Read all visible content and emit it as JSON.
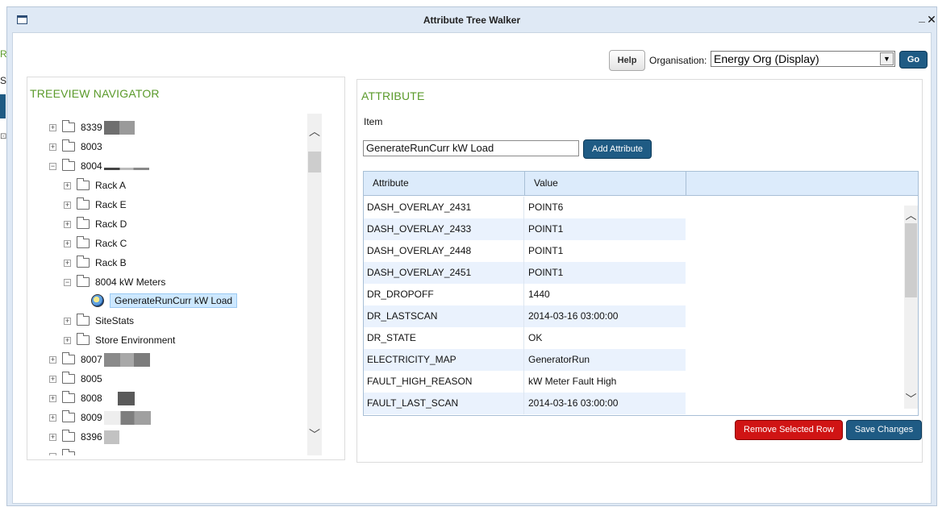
{
  "window": {
    "title": "Attribute Tree Walker",
    "minimize_glyph": "_",
    "close_glyph": "✕"
  },
  "toolbar": {
    "help_label": "Help",
    "organisation_label": "Organisation:",
    "organisation_value": "Energy Org (Display)",
    "go_label": "Go"
  },
  "tree": {
    "heading": "TREEVIEW NAVIGATOR",
    "items": [
      {
        "label": "8339",
        "expander": "+"
      },
      {
        "label": "8003",
        "expander": "+"
      },
      {
        "label": "8004",
        "expander": "−"
      },
      {
        "label": "Rack A",
        "expander": "+"
      },
      {
        "label": "Rack E",
        "expander": "+"
      },
      {
        "label": "Rack D",
        "expander": "+"
      },
      {
        "label": "Rack C",
        "expander": "+"
      },
      {
        "label": "Rack B",
        "expander": "+"
      },
      {
        "label": "8004 kW Meters",
        "expander": "−"
      },
      {
        "label": "GenerateRunCurr kW Load"
      },
      {
        "label": "SiteStats",
        "expander": "+"
      },
      {
        "label": "Store Environment",
        "expander": "+"
      },
      {
        "label": "8007",
        "expander": "+"
      },
      {
        "label": "8005",
        "expander": "+"
      },
      {
        "label": "8008",
        "expander": "+"
      },
      {
        "label": "8009",
        "expander": "+"
      },
      {
        "label": "8396",
        "expander": "+"
      }
    ]
  },
  "attribute": {
    "heading": "ATTRIBUTE",
    "item_label": "Item",
    "item_value": "GenerateRunCurr kW Load",
    "add_button": "Add Attribute",
    "columns": [
      "Attribute",
      "Value"
    ],
    "rows": [
      [
        "DASH_OVERLAY_2431",
        "POINT6"
      ],
      [
        "DASH_OVERLAY_2433",
        "POINT1"
      ],
      [
        "DASH_OVERLAY_2448",
        "POINT1"
      ],
      [
        "DASH_OVERLAY_2451",
        "POINT1"
      ],
      [
        "DR_DROPOFF",
        "1440"
      ],
      [
        "DR_LASTSCAN",
        "2014-03-16 03:00:00"
      ],
      [
        "DR_STATE",
        "OK"
      ],
      [
        "ELECTRICITY_MAP",
        "GeneratorRun"
      ],
      [
        "FAULT_HIGH_REASON",
        "kW Meter Fault High"
      ],
      [
        "FAULT_LAST_SCAN",
        "2014-03-16 03:00:00"
      ]
    ],
    "remove_button": "Remove Selected Row",
    "save_button": "Save Changes"
  },
  "colors": {
    "accent": "#1f5b84",
    "heading_green": "#5a9a2a",
    "danger": "#d01414",
    "selection": "#cde8ff"
  },
  "background_app": {
    "frag_1": "R",
    "frag_2": "Sit",
    "frag_3": "⊡"
  }
}
